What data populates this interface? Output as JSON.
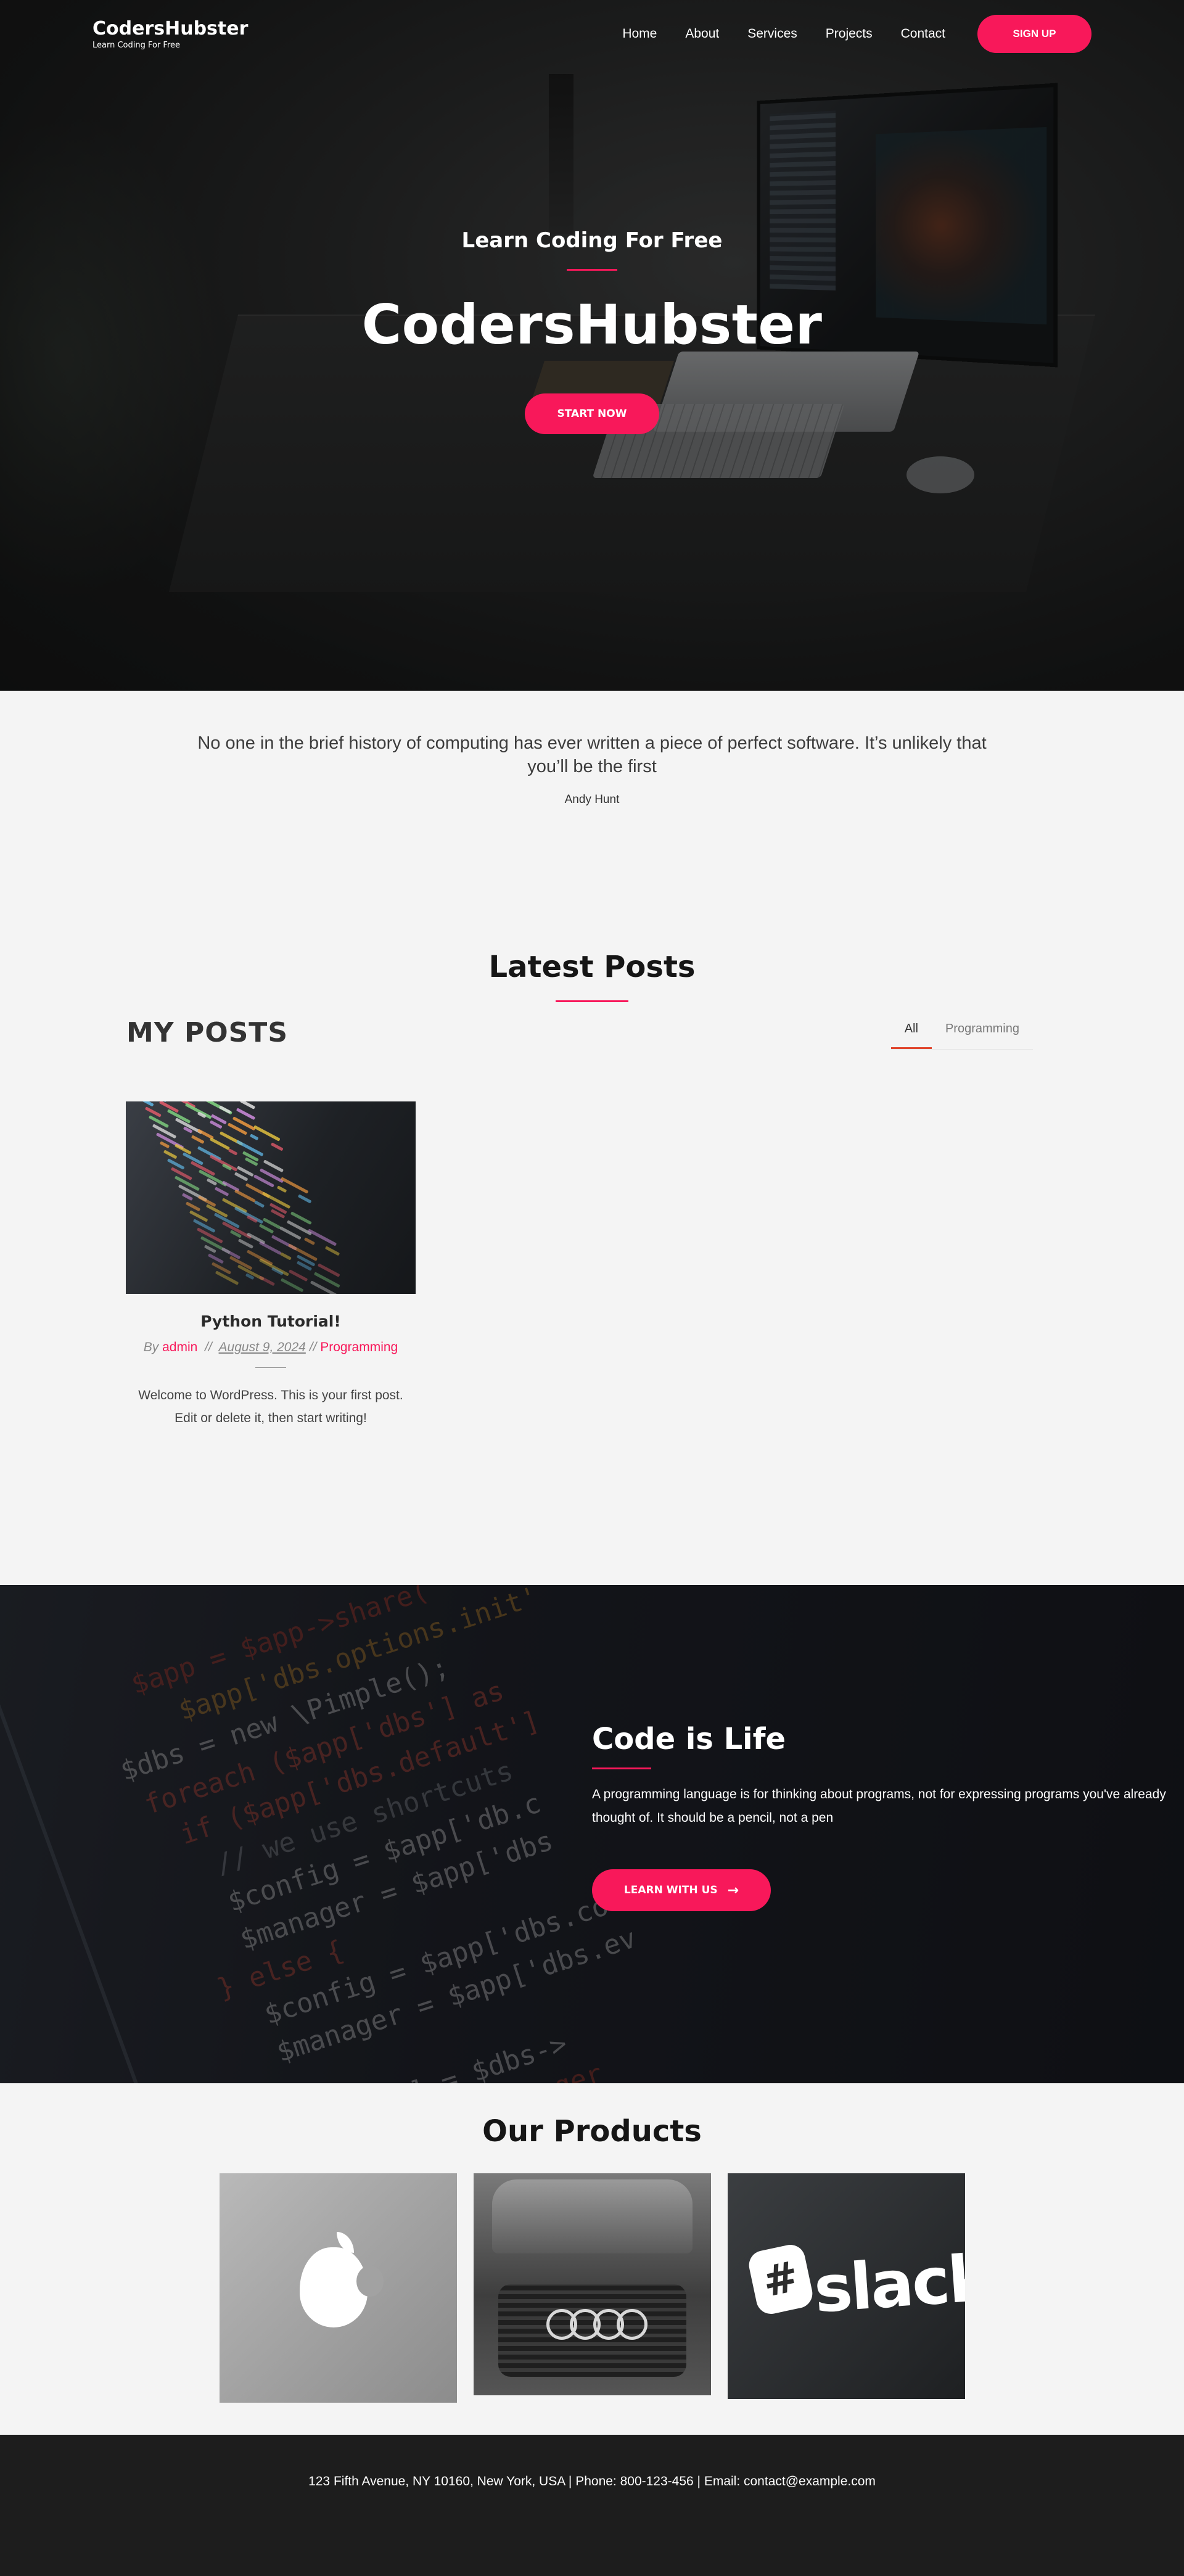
{
  "brand": {
    "name": "CodersHubster",
    "tagline": "Learn Coding For Free"
  },
  "nav": {
    "items": [
      "Home",
      "About",
      "Services",
      "Projects",
      "Contact"
    ],
    "signup_label": "SIGN UP"
  },
  "hero": {
    "subtitle": "Learn Coding For Free",
    "title": "CodersHubster",
    "button_label": "START NOW"
  },
  "quote": {
    "text": "No one in the brief history of computing has ever written a piece of perfect software. It’s unlikely that you’ll be the first",
    "author": "Andy Hunt"
  },
  "latest": {
    "title": "Latest Posts",
    "posts_heading": "MY POSTS",
    "filters": [
      "All",
      "Programming"
    ],
    "active_filter": "All",
    "post": {
      "title": "Python Tutorial!",
      "by": "By",
      "author": "admin",
      "sep1": "//",
      "date": "August 9, 2024",
      "sep2": "//",
      "category": "Programming",
      "excerpt": "Welcome to WordPress. This is your first post. Edit or delete it, then start writing!"
    }
  },
  "cta": {
    "title": "Code is Life",
    "text": "A programming language is for thinking about programs, not for expressing programs you've already thought of. It should be a pencil, not a pen",
    "button_label": "LEARN WITH US",
    "button_icon": "arrow-right-icon"
  },
  "products": {
    "title": "Our Products",
    "items": [
      "apple-logo-image",
      "audi-car-image",
      "slack-logo-image"
    ],
    "slack_word": "slack"
  },
  "footer": {
    "text": "123 Fifth Avenue, NY 10160, New York, USA | Phone: 800-123-456 | Email: contact@example.com"
  },
  "colors": {
    "accent": "#f8185a",
    "filter_underline": "#e0452d",
    "footer_bg": "#1d1d1d",
    "page_bg": "#f4f4f4"
  }
}
